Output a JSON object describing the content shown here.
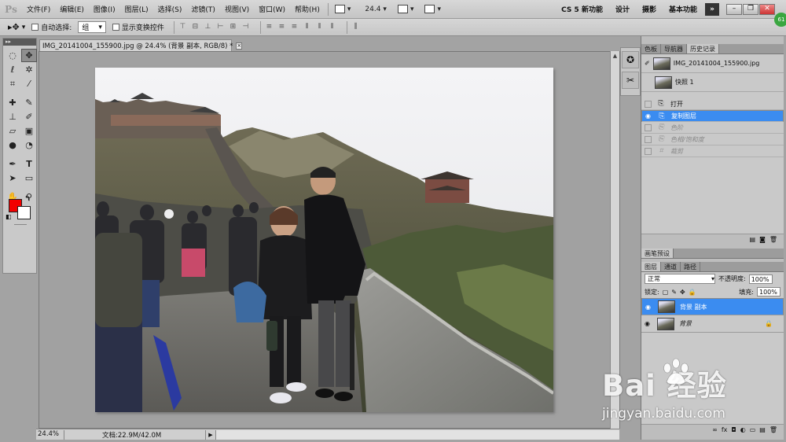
{
  "menubar": {
    "logo": "Ps",
    "items": [
      "文件(F)",
      "编辑(E)",
      "图像(I)",
      "图层(L)",
      "选择(S)",
      "滤镜(T)",
      "视图(V)",
      "窗口(W)",
      "帮助(H)"
    ],
    "zoom": "24.4",
    "workspaces": [
      "CS 5 新功能",
      "设计",
      "摄影",
      "基本功能"
    ],
    "more": "»"
  },
  "options": {
    "auto_select_label": "自动选择:",
    "auto_select_value": "组",
    "transform_label": "显示变换控件"
  },
  "document": {
    "tab_title": "IMG_20141004_155900.jpg @ 24.4% (背景 副本, RGB/8) *",
    "status_zoom": "24.4%",
    "status_docinfo": "文档:22.9M/42.0M"
  },
  "history_panel": {
    "tabs": [
      "色板",
      "导航器",
      "历史记录"
    ],
    "active_tab": "历史记录",
    "snapshots": [
      "IMG_20141004_155900.jpg",
      "快照 1"
    ],
    "steps": [
      {
        "label": "打开",
        "state": "normal"
      },
      {
        "label": "复制图层",
        "state": "selected"
      },
      {
        "label": "色阶",
        "state": "undone"
      },
      {
        "label": "色相/饱和度",
        "state": "undone"
      },
      {
        "label": "裁剪",
        "state": "undone"
      }
    ]
  },
  "brush_panel": {
    "title": "画笔预设"
  },
  "layers_panel": {
    "tabs": [
      "图层",
      "通道",
      "路径"
    ],
    "blend_mode": "正常",
    "opacity_label": "不透明度:",
    "opacity": "100%",
    "lock_label": "锁定:",
    "fill_label": "填充:",
    "fill": "100%",
    "layers": [
      {
        "name": "背景 副本",
        "selected": true,
        "locked": false
      },
      {
        "name": "背景",
        "selected": false,
        "locked": true
      }
    ]
  },
  "watermark": {
    "logo": "Bai   经验",
    "url": "jingyan.baidu.com"
  },
  "user_badge": "61",
  "colors": {
    "foreground": "#f20000",
    "background": "#ffffff",
    "selection": "#3b8cf0"
  }
}
